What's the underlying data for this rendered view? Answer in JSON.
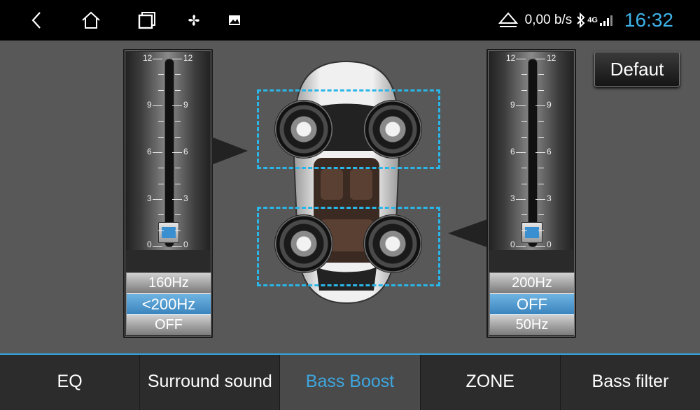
{
  "status_bar": {
    "icons": [
      "back-icon",
      "home-icon",
      "recent-apps-icon",
      "fan-icon",
      "image-icon",
      "eject-icon",
      "bluetooth-icon",
      "signal-icon"
    ],
    "net_speed": "0,00 b/s",
    "network": "4G",
    "time": "16:32",
    "accent_color": "#3fb2ea"
  },
  "left_panel": {
    "ticks": [
      "12",
      "9",
      "6",
      "3",
      "0"
    ],
    "level": 0,
    "frequency_options": [
      "160Hz",
      "<200Hz",
      "OFF"
    ],
    "selected": "<200Hz"
  },
  "right_panel": {
    "ticks": [
      "12",
      "9",
      "6",
      "3",
      "0"
    ],
    "level": 0,
    "frequency_options": [
      "200Hz",
      "OFF",
      "50Hz"
    ],
    "selected": "OFF"
  },
  "default_button": "Defaut",
  "tabs": [
    {
      "label": "EQ",
      "active": false
    },
    {
      "label": "Surround sound",
      "active": false
    },
    {
      "label": "Bass Boost",
      "active": true
    },
    {
      "label": "ZONE",
      "active": false
    },
    {
      "label": "Bass filter",
      "active": false
    }
  ],
  "colors": {
    "active_tab": "#3ea6df",
    "zone_outline": "#2ab6e8",
    "selected_option": "#4d9ad3"
  }
}
